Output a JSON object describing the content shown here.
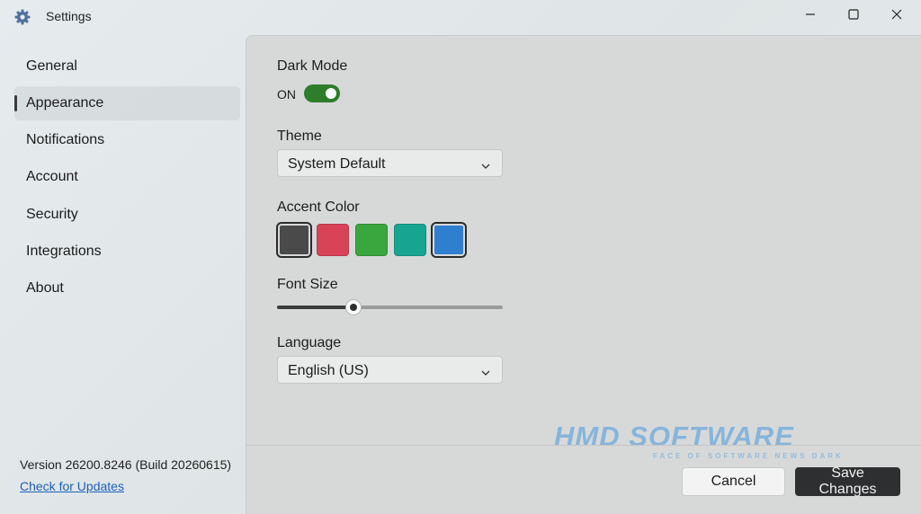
{
  "window": {
    "title": "Settings",
    "controls": {
      "minimize": "minimize-icon",
      "maximize": "maximize-icon",
      "close": "close-icon"
    }
  },
  "sidebar": {
    "items": [
      {
        "label": "General",
        "active": false
      },
      {
        "label": "Appearance",
        "active": true
      },
      {
        "label": "Notifications",
        "active": false
      },
      {
        "label": "Account",
        "active": false
      },
      {
        "label": "Security",
        "active": false
      },
      {
        "label": "Integrations",
        "active": false
      },
      {
        "label": "About",
        "active": false
      }
    ],
    "version": "Version 26200.8246 (Build 20260615)",
    "update_link": "Check for Updates"
  },
  "appearance": {
    "dark_mode": {
      "label": "Dark Mode",
      "state": "ON",
      "on": true
    },
    "theme": {
      "label": "Theme",
      "value": "System Default"
    },
    "accent": {
      "label": "Accent Color",
      "colors": [
        "#4a4a4a",
        "#d84358",
        "#3aa63e",
        "#17a592",
        "#2f7fd1"
      ],
      "selected_indices": [
        0,
        4
      ]
    },
    "font_size": {
      "label": "Font Size",
      "level_percent": 34
    },
    "language": {
      "label": "Language",
      "value": "English (US)"
    }
  },
  "footer": {
    "cancel_label": "Cancel",
    "save_label": "Save Changes"
  },
  "watermark": {
    "text": "HMD SOFTWARE",
    "subtext": "FACE OF SOFTWARE NEWS DARK"
  },
  "colors": {
    "toggle_on": "#2d7d2a",
    "link": "#1d5fb8",
    "primary_button": "#2e2f30"
  }
}
